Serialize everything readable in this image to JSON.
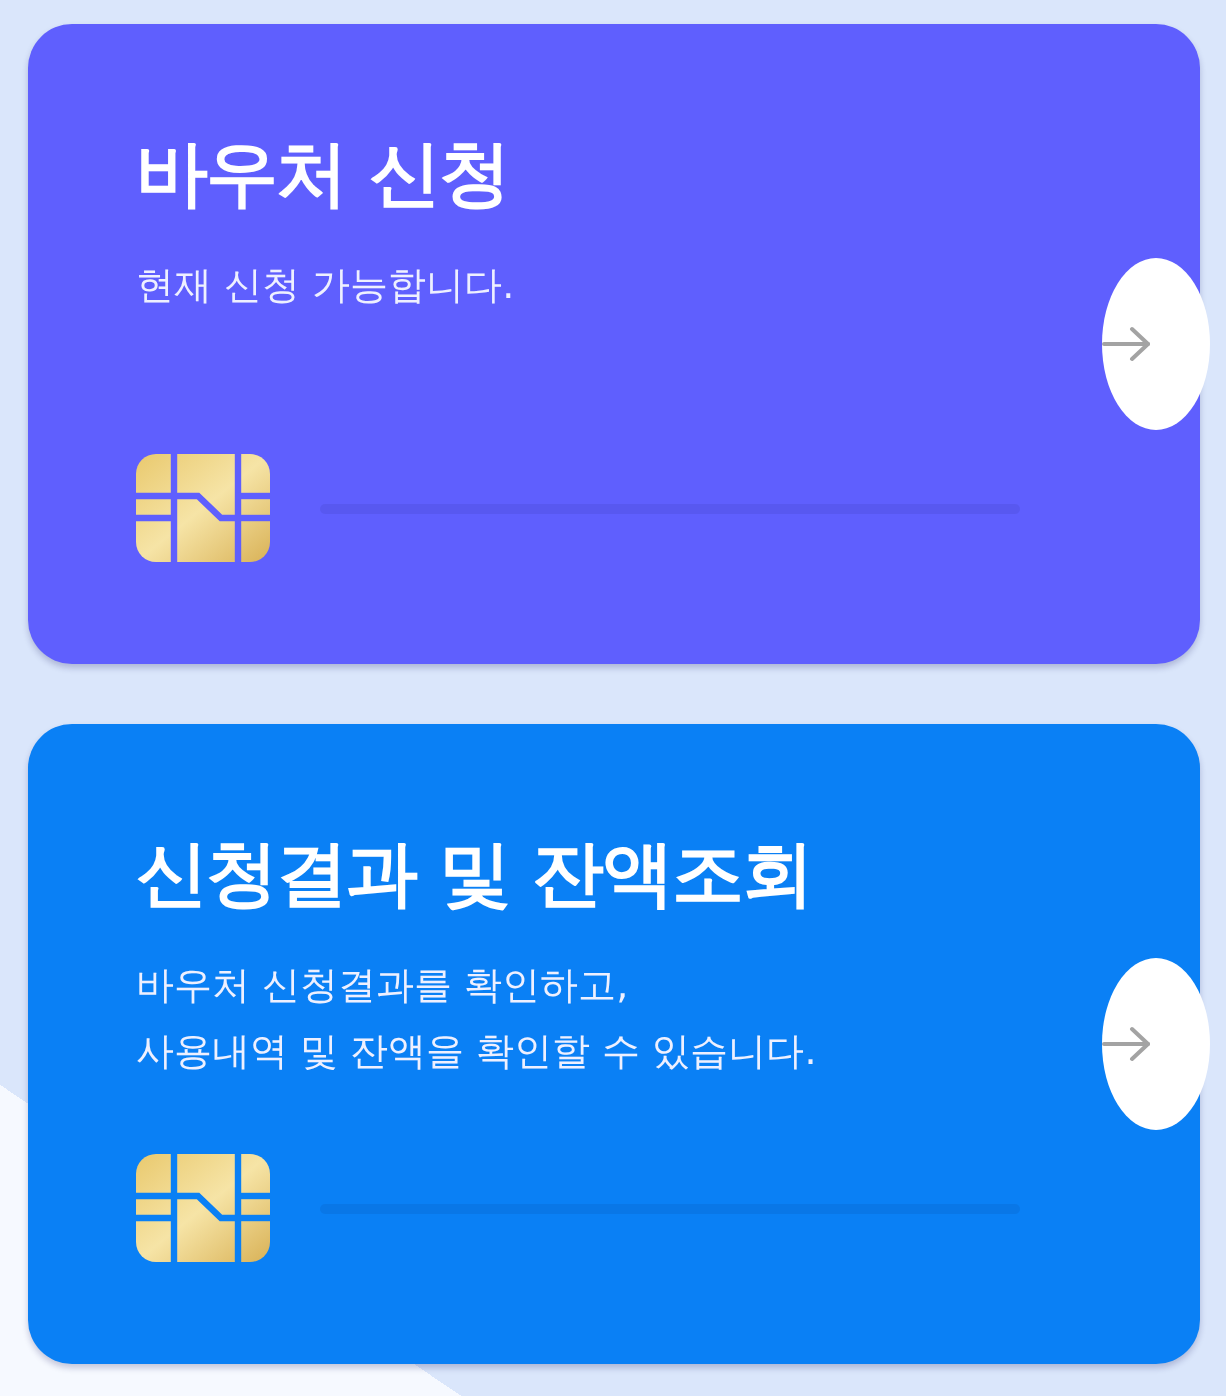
{
  "cards": [
    {
      "title": "바우처 신청",
      "description": "현재 신청 가능합니다.",
      "color": "#5f5ffe"
    },
    {
      "title": "신청결과 및 잔액조회",
      "description": "바우처 신청결과를 확인하고,\n사용내역 및 잔액을 확인할 수 있습니다.",
      "color": "#0a80f5"
    }
  ]
}
